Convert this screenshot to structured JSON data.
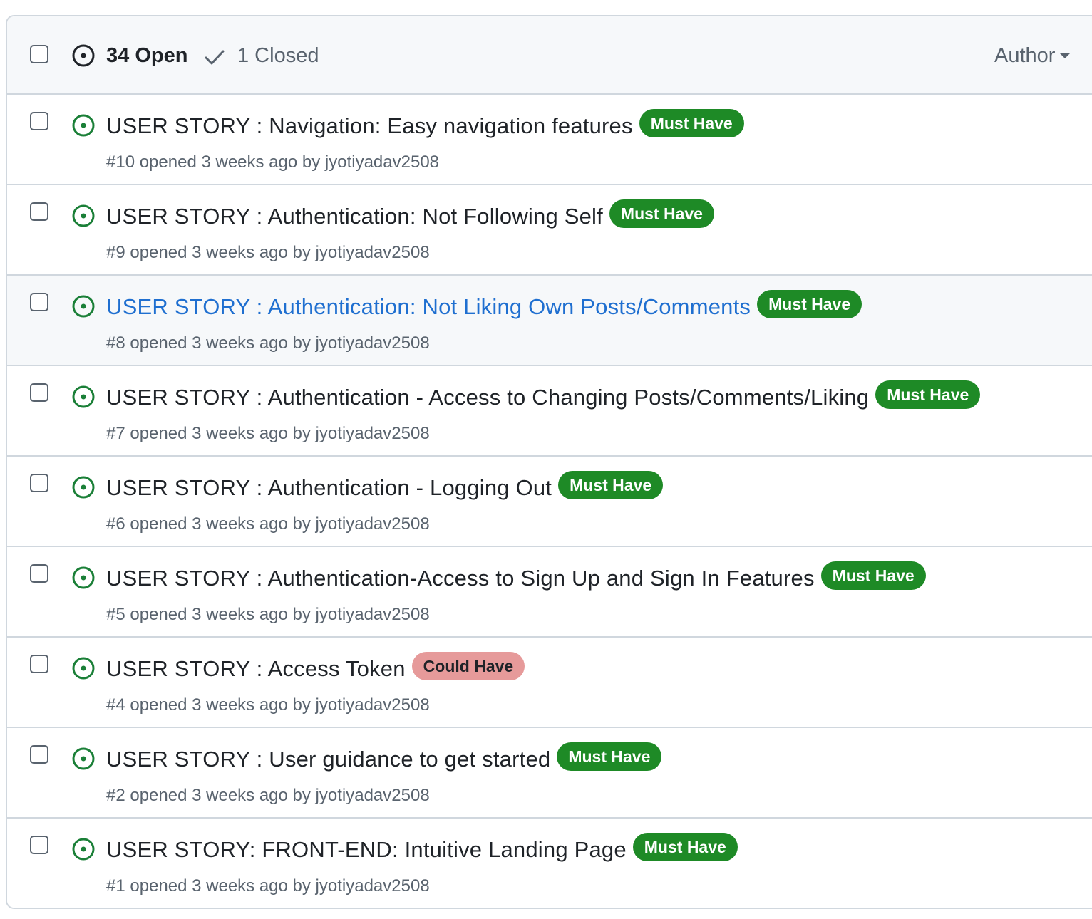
{
  "header": {
    "open_label": "34 Open",
    "closed_label": "1 Closed",
    "author_label": "Author"
  },
  "colors": {
    "open_icon": "#1a7f37",
    "must_have_bg": "#1e8a26",
    "must_have_fg": "#ffffff",
    "could_have_bg": "#e69a9a",
    "could_have_fg": "#1f2328",
    "link_hover": "#1f6fd0"
  },
  "issues": [
    {
      "title": "USER STORY : Navigation: Easy navigation features",
      "label": "Must Have",
      "meta": "#10 opened 3 weeks ago by jyotiyadav2508"
    },
    {
      "title": "USER STORY : Authentication: Not Following Self",
      "label": "Must Have",
      "meta": "#9 opened 3 weeks ago by jyotiyadav2508"
    },
    {
      "title": "USER STORY : Authentication: Not Liking Own Posts/Comments",
      "label": "Must Have",
      "meta": "#8 opened 3 weeks ago by jyotiyadav2508"
    },
    {
      "title": "USER STORY : Authentication - Access to Changing Posts/Comments/Liking",
      "label": "Must Have",
      "meta": "#7 opened 3 weeks ago by jyotiyadav2508"
    },
    {
      "title": "USER STORY : Authentication - Logging Out",
      "label": "Must Have",
      "meta": "#6 opened 3 weeks ago by jyotiyadav2508"
    },
    {
      "title": "USER STORY : Authentication-Access to Sign Up and Sign In Features",
      "label": "Must Have",
      "meta": "#5 opened 3 weeks ago by jyotiyadav2508"
    },
    {
      "title": "USER STORY : Access Token",
      "label": "Could Have",
      "meta": "#4 opened 3 weeks ago by jyotiyadav2508"
    },
    {
      "title": "USER STORY : User guidance to get started",
      "label": "Must Have",
      "meta": "#2 opened 3 weeks ago by jyotiyadav2508"
    },
    {
      "title": "USER STORY: FRONT-END: Intuitive Landing Page",
      "label": "Must Have",
      "meta": "#1 opened 3 weeks ago by jyotiyadav2508"
    }
  ]
}
